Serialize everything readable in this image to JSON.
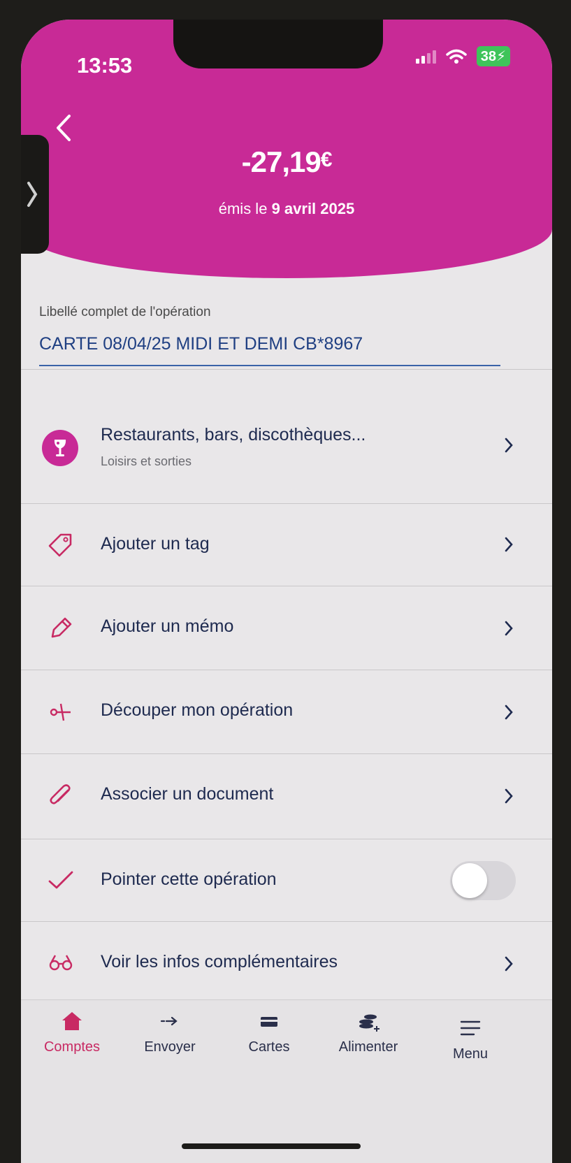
{
  "status_bar": {
    "time": "13:53",
    "battery": "38"
  },
  "header": {
    "amount": "-27,19",
    "currency": "€",
    "issued_prefix": "émis le",
    "issued_date": "9 avril 2025"
  },
  "libelle": {
    "label": "Libellé complet de l'opération",
    "value": "CARTE 08/04/25 MIDI ET DEMI CB*8967"
  },
  "category": {
    "title": "Restaurants, bars, discothèques...",
    "subtitle": "Loisirs et sorties"
  },
  "actions": {
    "add_tag": "Ajouter un tag",
    "add_memo": "Ajouter un mémo",
    "split": "Découper mon opération",
    "attach": "Associer un document",
    "mark": "Pointer cette opération",
    "more_info": "Voir les infos complémentaires"
  },
  "toggle_state": "off",
  "tabbar": {
    "accounts": "Comptes",
    "send": "Envoyer",
    "cards": "Cartes",
    "top_up": "Alimenter",
    "menu": "Menu"
  },
  "colors": {
    "brand": "#c82a96",
    "accent_red": "#c82a63",
    "text_navy": "#1e2a4f"
  }
}
